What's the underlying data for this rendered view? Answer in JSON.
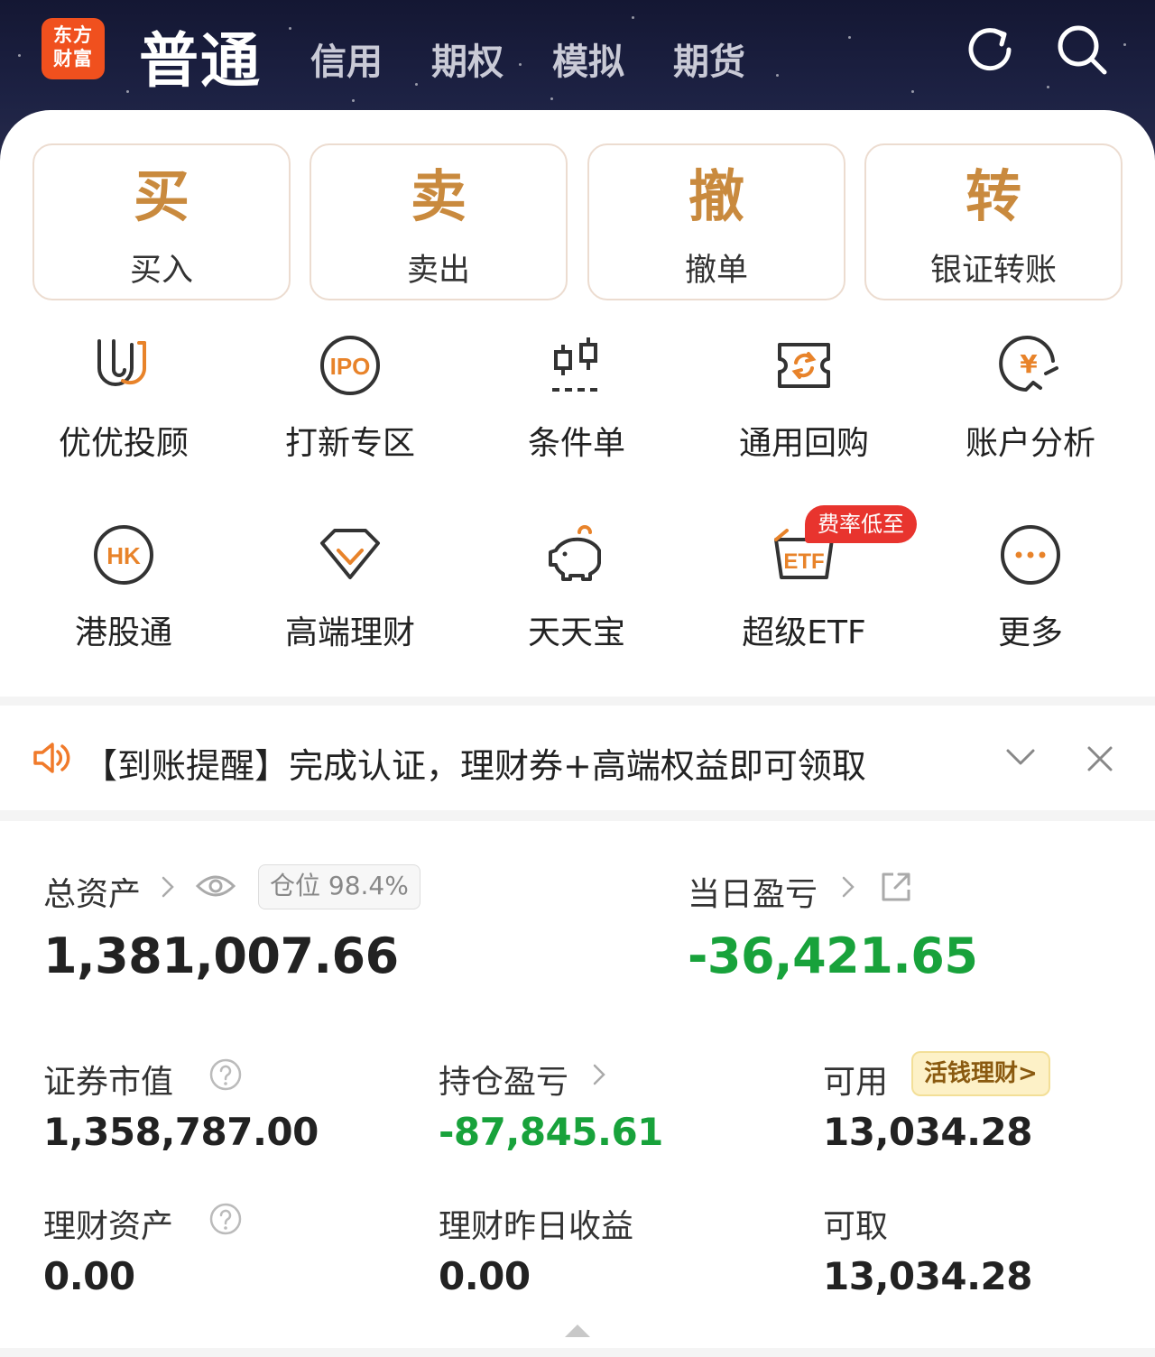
{
  "header": {
    "logo_line1": "东方",
    "logo_line2": "财富",
    "tabs": [
      "普通",
      "信用",
      "期权",
      "模拟",
      "期货"
    ],
    "icons": [
      "refresh-icon",
      "search-icon"
    ]
  },
  "trade_buttons": [
    {
      "glyph": "买",
      "label": "买入"
    },
    {
      "glyph": "卖",
      "label": "卖出"
    },
    {
      "glyph": "撤",
      "label": "撤单"
    },
    {
      "glyph": "转",
      "label": "银证转账"
    }
  ],
  "features_row1": [
    {
      "icon": "uu-advisor-icon",
      "label": "优优投顾"
    },
    {
      "icon": "ipo-icon",
      "label": "打新专区",
      "icon_text": "IPO"
    },
    {
      "icon": "candlestick-icon",
      "label": "条件单"
    },
    {
      "icon": "repurchase-icon",
      "label": "通用回购"
    },
    {
      "icon": "yuan-analysis-icon",
      "label": "账户分析",
      "icon_text": "¥"
    }
  ],
  "features_row2": [
    {
      "icon": "hk-icon",
      "label": "港股通",
      "icon_text": "HK"
    },
    {
      "icon": "diamond-icon",
      "label": "高端理财"
    },
    {
      "icon": "piggy-bank-icon",
      "label": "天天宝"
    },
    {
      "icon": "etf-basket-icon",
      "label": "超级ETF",
      "icon_text": "ETF",
      "badge": "费率低至"
    },
    {
      "icon": "more-icon",
      "label": "更多"
    }
  ],
  "notice": {
    "text": "【到账提醒】完成认证，理财券+高端权益即可领取",
    "icons": [
      "speaker-icon",
      "chevron-down-icon",
      "close-icon"
    ]
  },
  "assets": {
    "total_label": "总资产",
    "position_pill": "仓位 98.4%",
    "total_value": "1,381,007.66",
    "daily_pl_label": "当日盈亏",
    "daily_pl_value": "-36,421.65",
    "market_value_label": "证券市值",
    "market_value": "1,358,787.00",
    "holding_pl_label": "持仓盈亏",
    "holding_pl_value": "-87,845.61",
    "available_label": "可用",
    "available_value": "13,034.28",
    "huoqian_label": "活钱理财>",
    "wealth_label": "理财资产",
    "wealth_value": "0.00",
    "wealth_yesterday_label": "理财昨日收益",
    "wealth_yesterday_value": "0.00",
    "withdrawable_label": "可取",
    "withdrawable_value": "13,034.28"
  },
  "colors": {
    "accent_gold": "#c98a3e",
    "icon_orange": "#e8832a",
    "negative_green": "#18a23b",
    "logo_orange": "#f0501e",
    "badge_red": "#e8342e"
  }
}
